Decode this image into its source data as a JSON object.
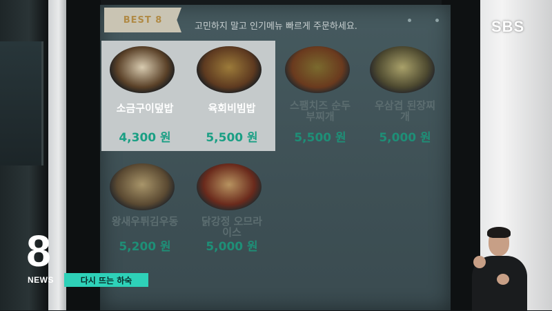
{
  "broadcaster": {
    "logo": "SBS"
  },
  "program": {
    "number": "8",
    "name": "NEWS"
  },
  "caption": "다시 뜨는 하숙",
  "kiosk": {
    "best_tab": "BEST 8",
    "header_text": "고민하지 말고 인기메뉴 빠르게 주문하세요.",
    "items": [
      {
        "name": "소금구이덮밥",
        "price": "4,300 원",
        "highlighted": true,
        "icon": "rice-bowl-grilled-meat"
      },
      {
        "name": "육회비빔밥",
        "price": "5,500 원",
        "highlighted": true,
        "icon": "bibimbap-bowl"
      },
      {
        "name": "스팸치즈 순두\n부찌개",
        "price": "5,500 원",
        "highlighted": false,
        "icon": "stew-pot"
      },
      {
        "name": "우삼겹 된장찌\n개",
        "price": "5,000 원",
        "highlighted": false,
        "icon": "soybean-stew-pot"
      },
      {
        "name": "왕새우튀김우동",
        "price": "5,200 원",
        "highlighted": false,
        "icon": "udon-bowl"
      },
      {
        "name": "닭강정 오므라\n이스",
        "price": "5,000 원",
        "highlighted": false,
        "icon": "omurice-plate"
      }
    ]
  }
}
